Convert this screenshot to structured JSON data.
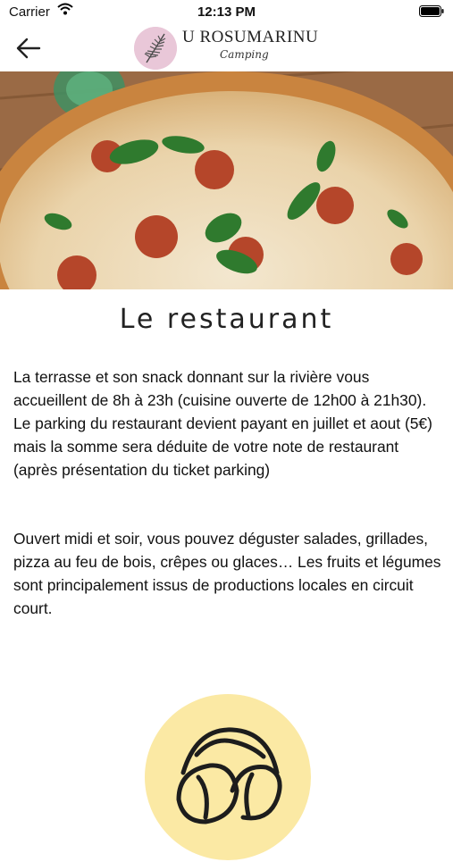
{
  "status_bar": {
    "carrier": "Carrier",
    "time": "12:13 PM"
  },
  "header": {
    "brand": "U ROSUMARINU",
    "subtitle": "Camping"
  },
  "content": {
    "title": "Le restaurant",
    "paragraphs": [
      "La terrasse et son snack donnant sur la rivière vous accueillent de 8h à 23h (cuisine ouverte de 12h00 à 21h30). Le parking du restaurant devient payant en juillet et aout (5€) mais la somme sera déduite de votre note de restaurant (après présentation du ticket parking)",
      "Ouvert midi et soir, vous pouvez déguster salades, grillades, pizza au feu de bois, crêpes ou glaces… Les fruits et légumes sont principalement issus de productions locales en circuit court."
    ]
  },
  "icons": {
    "back": "arrow-left-icon",
    "wifi": "wifi-icon",
    "battery": "battery-icon",
    "logo": "rosemary-logo-icon",
    "croissant": "croissant-icon"
  },
  "colors": {
    "logo_circle": "#e9c7d8",
    "badge_yellow": "#fbe9a4",
    "text": "#111111"
  }
}
